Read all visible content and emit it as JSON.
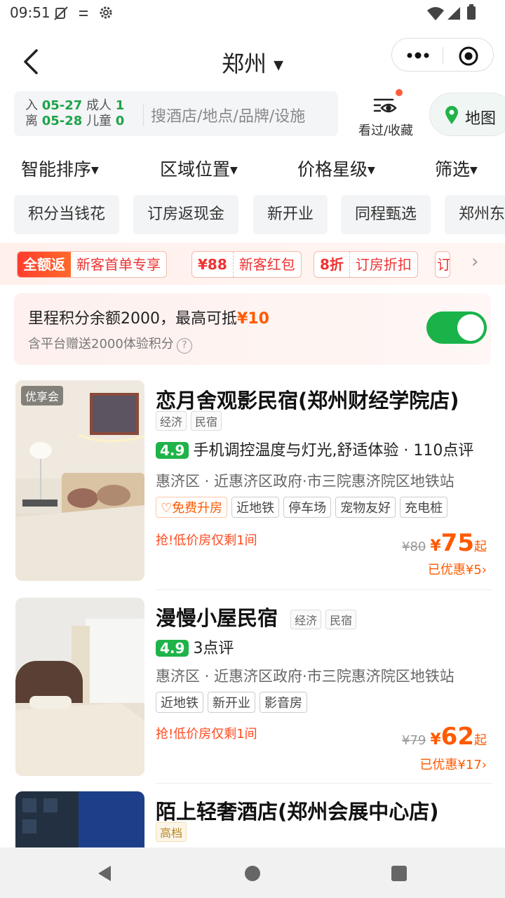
{
  "status": {
    "time": "09:51"
  },
  "nav": {
    "city": "郑州"
  },
  "search": {
    "checkin_label": "入",
    "checkin_date": "05-27",
    "checkout_label": "离",
    "checkout_date": "05-28",
    "adults_label": "成人",
    "adults": "1",
    "children_label": "儿童",
    "children": "0",
    "placeholder": "搜酒店/地点/品牌/设施",
    "seen_label": "看过/收藏",
    "map_label": "地图"
  },
  "sort": [
    "智能排序",
    "区域位置",
    "价格星级",
    "筛选"
  ],
  "tags": [
    "积分当钱花",
    "订房返现金",
    "新开业",
    "同程甄选",
    "郑州东"
  ],
  "promos": [
    {
      "a": "全额返",
      "b": "新客首单专享"
    },
    {
      "a": "¥88",
      "b": "新客红包"
    },
    {
      "a": "8折",
      "b": "订房折扣"
    },
    {
      "a": "订",
      "b": ""
    }
  ],
  "points": {
    "line1": "里程积分余额2000，最高可抵",
    "amount": "¥10",
    "line2": "含平台赠送2000体验积分",
    "help": "?",
    "enabled": true
  },
  "colors": {
    "accent": "#ff5a00",
    "green": "#1fb34a"
  },
  "hotels": [
    {
      "badge": "优享会",
      "name": "恋月舍观影民宿(郑州财经学院店)",
      "tags": [
        "经济",
        "民宿"
      ],
      "score": "4.9",
      "review": "手机调控温度与灯光,舒适体验 · 110点评",
      "address": "惠济区 · 近惠济区政府·市三院惠济院区地铁站",
      "upgrade": "免费升房",
      "facilities": [
        "近地铁",
        "停车场",
        "宠物友好",
        "充电桩"
      ],
      "urgent": "抢!低价房仅剩1间",
      "old_price": "¥80",
      "price": "75",
      "qi": "起",
      "saved": "已优惠¥5"
    },
    {
      "name": "漫慢小屋民宿",
      "tags": [
        "经济",
        "民宿"
      ],
      "score": "4.9",
      "review": "3点评",
      "address": "惠济区 · 近惠济区政府·市三院惠济院区地铁站",
      "facilities": [
        "近地铁",
        "新开业",
        "影音房"
      ],
      "urgent": "抢!低价房仅剩1间",
      "old_price": "¥79",
      "price": "62",
      "qi": "起",
      "saved": "已优惠¥17"
    },
    {
      "name": "陌上轻奢酒店(郑州会展中心店)",
      "tags": [
        "高档"
      ]
    }
  ],
  "currency": "¥"
}
